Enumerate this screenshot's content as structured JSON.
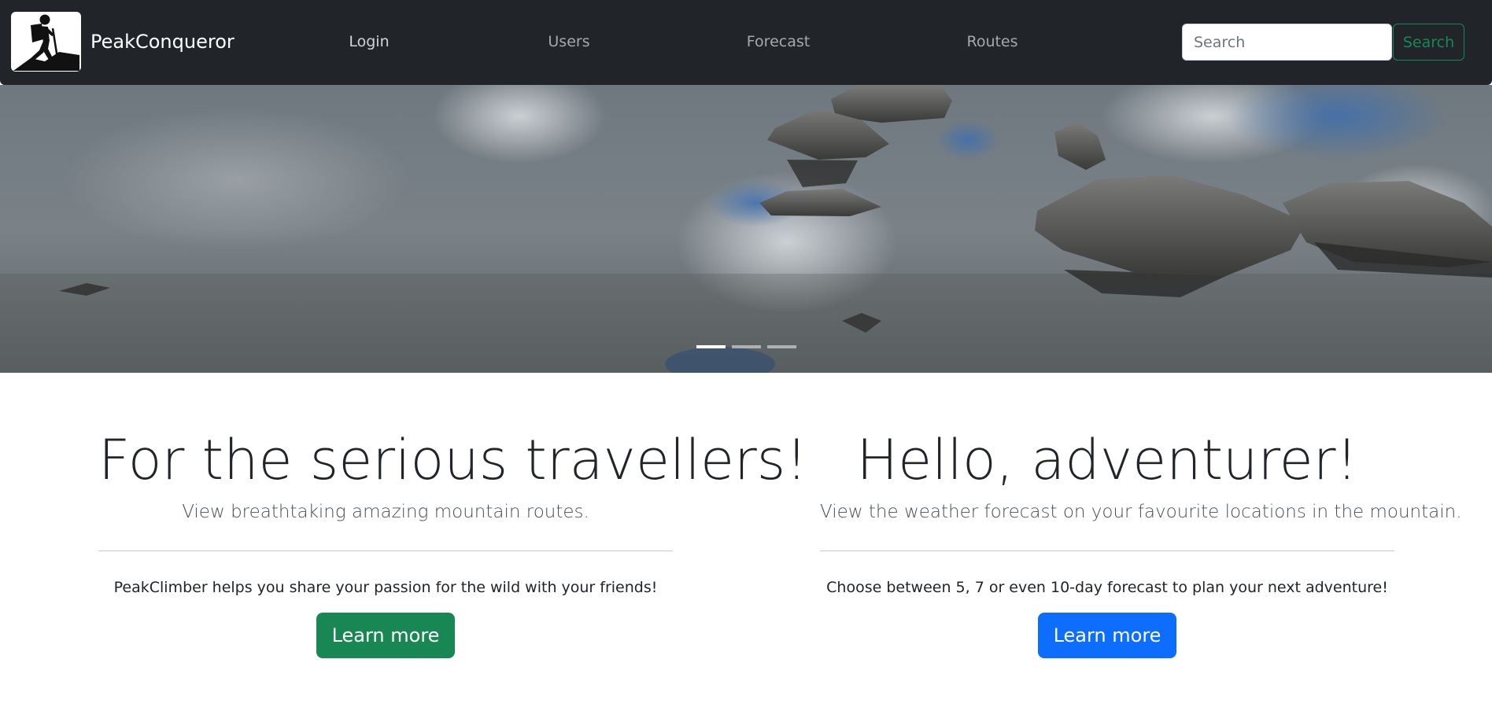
{
  "brand": {
    "name": "PeakConqueror",
    "logo_icon": "hiker-icon"
  },
  "nav": [
    {
      "label": "Login"
    },
    {
      "label": "Users"
    },
    {
      "label": "Forecast"
    },
    {
      "label": "Routes"
    }
  ],
  "search": {
    "placeholder": "Search",
    "button_label": "Search",
    "button_color": "#198754"
  },
  "carousel": {
    "slide_count": 3,
    "active_index": 0,
    "image": "mountain-lake-with-rocks"
  },
  "features": [
    {
      "heading": "For the serious travellers!",
      "lead": "View breathtaking amazing mountain routes.",
      "body": "PeakClimber helps you share your passion for the wild with your friends!",
      "button_label": "Learn more",
      "button_color": "#198754"
    },
    {
      "heading": "Hello, adventurer!",
      "lead": "View the weather forecast on your favourite locations in the mountain.",
      "body": "Choose between 5, 7 or even 10-day forecast to plan your next adventure!",
      "button_label": "Learn more",
      "button_color": "#0d6efd"
    }
  ],
  "colors": {
    "navbar_bg": "#212529"
  }
}
